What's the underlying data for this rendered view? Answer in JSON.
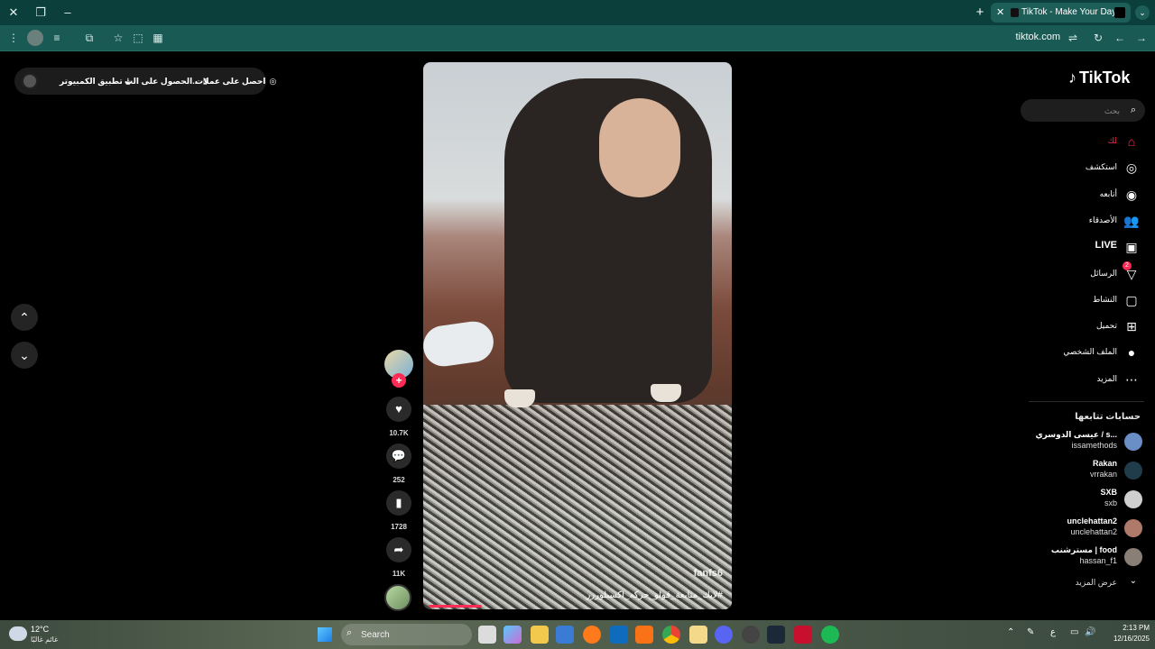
{
  "browser": {
    "tab_title": "TikTok - Make Your Day",
    "url": "tiktok.com"
  },
  "topbar": {
    "coins": "احصل على عملات",
    "get_app": "الحصول على الت...",
    "desktop_app": "تطبيق الكمبيوتر"
  },
  "video": {
    "watermark": "fanfs6",
    "caption": "#لايك_متابعة_قولو_حركه_اكسبلوررر",
    "progress": 0.18
  },
  "actions": {
    "likes": "10.7K",
    "comments": "252",
    "saves": "1728",
    "shares": "11K"
  },
  "sidebar": {
    "logo": "TikTok",
    "search_placeholder": "بحث",
    "nav": [
      {
        "label": "لك",
        "icon": "home-icon"
      },
      {
        "label": "استكشف",
        "icon": "compass-icon"
      },
      {
        "label": "أتابعه",
        "icon": "following-icon"
      },
      {
        "label": "الأصدقاء",
        "icon": "friends-icon"
      },
      {
        "label": "LIVE",
        "icon": "live-icon"
      },
      {
        "label": "الرسائل",
        "icon": "messages-icon",
        "badge": "2"
      },
      {
        "label": "النشاط",
        "icon": "activity-icon"
      },
      {
        "label": "تحميل",
        "icon": "upload-icon"
      },
      {
        "label": "الملف الشخصي",
        "icon": "profile-icon"
      },
      {
        "label": "المزيد",
        "icon": "more-icon"
      }
    ],
    "following_title": "حسابات تتابعها",
    "accounts": [
      {
        "name": "عيسى الدوسري / s...",
        "user": "issamethods"
      },
      {
        "name": "Rakan",
        "user": "vrrakan"
      },
      {
        "name": "SXB",
        "user": "sxb"
      },
      {
        "name": "unclehattan2",
        "user": "unclehattan2"
      },
      {
        "name": "مسترشنب | food",
        "user": "hassan_f1"
      }
    ],
    "see_more": "عرض المزيد"
  },
  "taskbar": {
    "temp": "12°C",
    "condition": "غائم غالبًا",
    "search_placeholder": "Search",
    "time": "2:13 PM",
    "date": "12/16/2025",
    "lang": "ع"
  },
  "colors": {
    "accent": "#fe2c55",
    "chrome": "#0b3f3b"
  }
}
